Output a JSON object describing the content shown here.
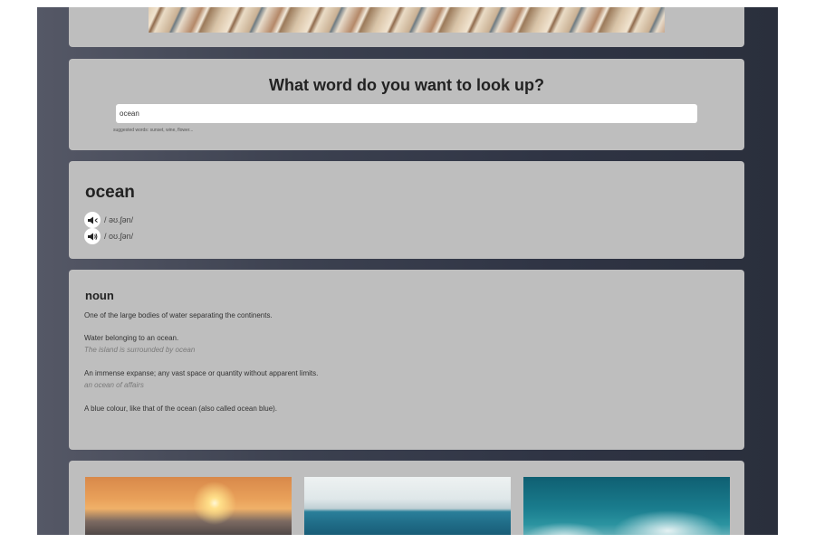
{
  "search": {
    "title": "What word do you want to look up?",
    "value": "ocean",
    "suggested": "suggested words: sunset, wine, flower..."
  },
  "word": {
    "title": "ocean",
    "pronunciations": [
      {
        "text": "/ əʊ.ʃən/",
        "icon": "speaker-icon"
      },
      {
        "text": "/ oʊ.ʃən/",
        "icon": "speaker-loud-icon"
      }
    ]
  },
  "definitions": {
    "part_of_speech": "noun",
    "items": [
      {
        "definition": "One of the large bodies of water separating the continents.",
        "example": ""
      },
      {
        "definition": "Water belonging to an ocean.",
        "example": "The island is surrounded by ocean"
      },
      {
        "definition": "An immense expanse; any vast space or quantity without apparent limits.",
        "example": "an ocean of affairs"
      },
      {
        "definition": "A blue colour, like that of the ocean (also called ocean blue).",
        "example": ""
      }
    ]
  },
  "images": [
    {
      "name": "sunset-ocean-image"
    },
    {
      "name": "sea-horizon-image"
    },
    {
      "name": "ocean-waves-image"
    }
  ]
}
